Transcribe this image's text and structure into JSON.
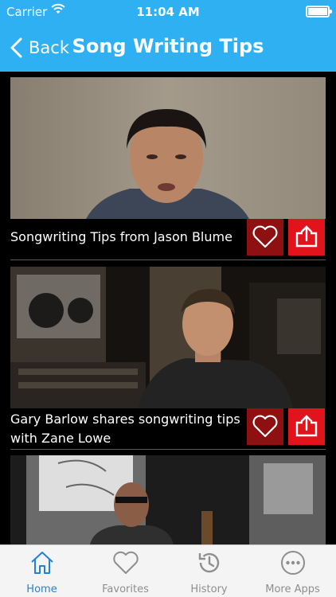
{
  "status": {
    "carrier": "Carrier",
    "time": "11:04 AM"
  },
  "nav": {
    "back_label": "Back",
    "title": "Song Writing Tips"
  },
  "videos": [
    {
      "title": "Songwriting Tips from Jason Blume"
    },
    {
      "title": "Gary Barlow shares songwriting tips with Zane Lowe"
    },
    {
      "title": ""
    }
  ],
  "tabs": [
    {
      "label": "Home",
      "icon": "home-icon",
      "active": true
    },
    {
      "label": "Favorites",
      "icon": "heart-icon",
      "active": false
    },
    {
      "label": "History",
      "icon": "history-icon",
      "active": false
    },
    {
      "label": "More Apps",
      "icon": "more-icon",
      "active": false
    }
  ],
  "colors": {
    "nav": "#2fb0f2",
    "favorite_btn": "#8f1010",
    "share_btn": "#e0141a",
    "active_tab": "#1f82d9",
    "inactive_tab": "#8e8e8e"
  }
}
